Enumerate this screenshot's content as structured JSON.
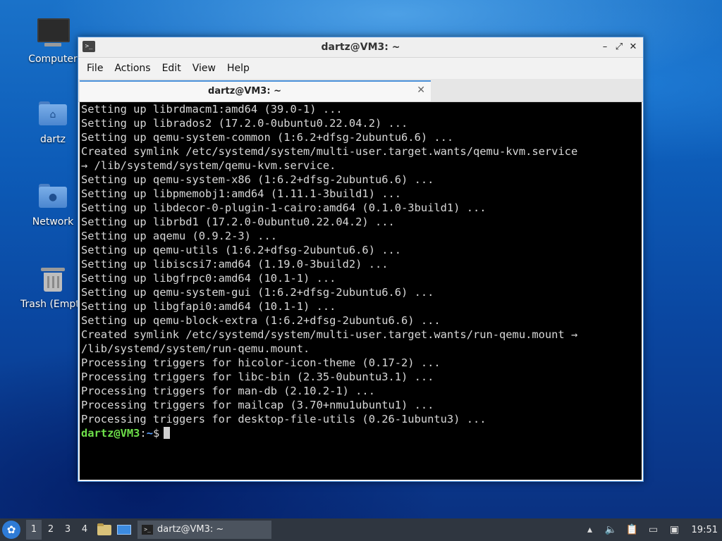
{
  "desktop": {
    "icons": [
      {
        "label": "Computer",
        "icon": "computer-icon"
      },
      {
        "label": "dartz",
        "icon": "home-folder-icon"
      },
      {
        "label": "Network",
        "icon": "network-folder-icon"
      },
      {
        "label": "Trash (Empty)",
        "icon": "trash-icon"
      }
    ]
  },
  "window": {
    "title": "dartz@VM3: ~",
    "menu": [
      "File",
      "Actions",
      "Edit",
      "View",
      "Help"
    ],
    "tab_title": "dartz@VM3: ~",
    "tab_close": "✕",
    "controls": {
      "minimize": "–",
      "maximize": "⤢",
      "close": "✕"
    }
  },
  "terminal": {
    "lines": [
      "Setting up librdmacm1:amd64 (39.0-1) ...",
      "Setting up librados2 (17.2.0-0ubuntu0.22.04.2) ...",
      "Setting up qemu-system-common (1:6.2+dfsg-2ubuntu6.6) ...",
      "Created symlink /etc/systemd/system/multi-user.target.wants/qemu-kvm.service",
      "→ /lib/systemd/system/qemu-kvm.service.",
      "Setting up qemu-system-x86 (1:6.2+dfsg-2ubuntu6.6) ...",
      "Setting up libpmemobj1:amd64 (1.11.1-3build1) ...",
      "Setting up libdecor-0-plugin-1-cairo:amd64 (0.1.0-3build1) ...",
      "Setting up librbd1 (17.2.0-0ubuntu0.22.04.2) ...",
      "Setting up aqemu (0.9.2-3) ...",
      "Setting up qemu-utils (1:6.2+dfsg-2ubuntu6.6) ...",
      "Setting up libiscsi7:amd64 (1.19.0-3build2) ...",
      "Setting up libgfrpc0:amd64 (10.1-1) ...",
      "Setting up qemu-system-gui (1:6.2+dfsg-2ubuntu6.6) ...",
      "Setting up libgfapi0:amd64 (10.1-1) ...",
      "Setting up qemu-block-extra (1:6.2+dfsg-2ubuntu6.6) ...",
      "Created symlink /etc/systemd/system/multi-user.target.wants/run-qemu.mount →",
      "/lib/systemd/system/run-qemu.mount.",
      "Processing triggers for hicolor-icon-theme (0.17-2) ...",
      "Processing triggers for libc-bin (2.35-0ubuntu3.1) ...",
      "Processing triggers for man-db (2.10.2-1) ...",
      "Processing triggers for mailcap (3.70+nmu1ubuntu1) ...",
      "Processing triggers for desktop-file-utils (0.26-1ubuntu3) ..."
    ],
    "prompt": {
      "user": "dartz@VM3",
      "sep": ":",
      "path": "~",
      "symbol": "$"
    }
  },
  "taskbar": {
    "workspaces": [
      "1",
      "2",
      "3",
      "4"
    ],
    "active_workspace": "1",
    "task_label": "dartz@VM3: ~",
    "clock": "19:51"
  }
}
